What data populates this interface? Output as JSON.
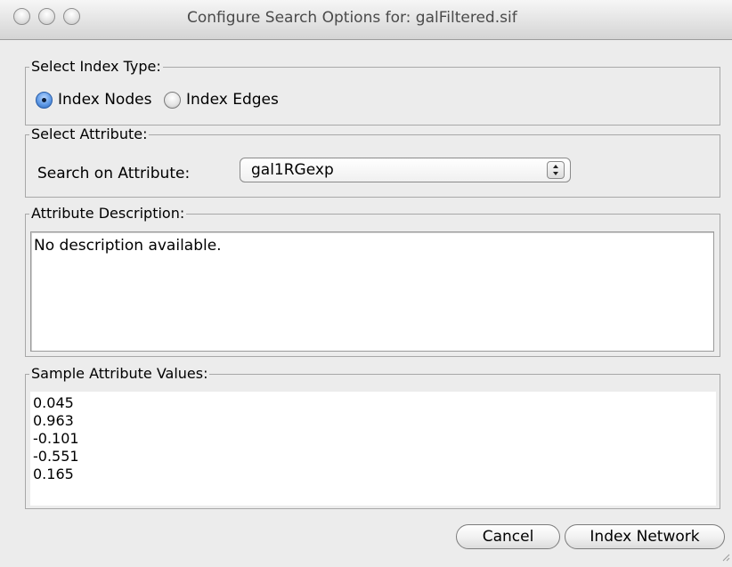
{
  "window": {
    "title": "Configure Search Options for:  galFiltered.sif"
  },
  "index_type": {
    "legend": "Select Index Type:",
    "options": [
      {
        "label": "Index Nodes",
        "checked": true
      },
      {
        "label": "Index Edges",
        "checked": false
      }
    ]
  },
  "attribute": {
    "legend": "Select Attribute:",
    "label": "Search on Attribute:",
    "selected": "gal1RGexp"
  },
  "description": {
    "legend": "Attribute Description:",
    "text": "No description available."
  },
  "samples": {
    "legend": "Sample Attribute Values:",
    "values": [
      "0.045",
      "0.963",
      "-0.101",
      "-0.551",
      "0.165"
    ]
  },
  "buttons": {
    "cancel": "Cancel",
    "index_network": "Index Network"
  },
  "colors": {
    "selected_radio": "#2c64b6",
    "window_bg": "#ececec"
  }
}
